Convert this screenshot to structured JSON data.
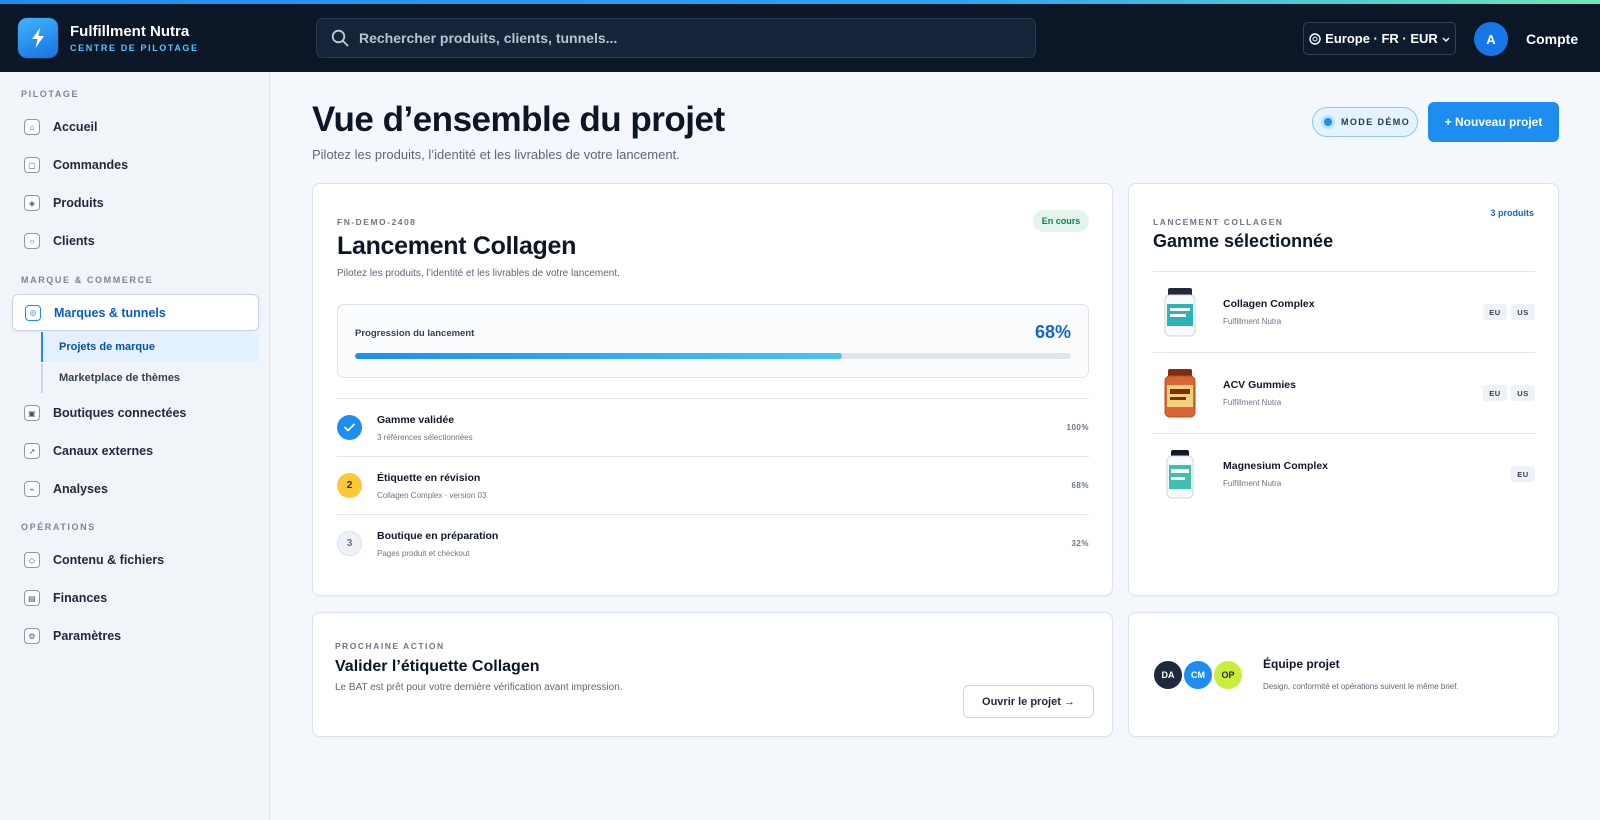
{
  "app": {
    "brand_name": "Fulfillment Nutra",
    "brand_sub": "CENTRE DE PILOTAGE",
    "search_placeholder": "Rechercher produits, clients, tunnels...",
    "region": "Europe · FR · EUR",
    "avatar_initial": "A",
    "account_label": "Compte"
  },
  "sidebar": {
    "sections": [
      "PILOTAGE",
      "MARQUE & COMMERCE",
      "OPÉRATIONS"
    ],
    "items": [
      {
        "label": "Accueil",
        "icon": "home-icon"
      },
      {
        "label": "Commandes",
        "icon": "orders-icon"
      },
      {
        "label": "Produits",
        "icon": "products-icon"
      },
      {
        "label": "Clients",
        "icon": "clients-icon"
      },
      {
        "label": "Marques & tunnels",
        "icon": "brands-icon"
      },
      {
        "label": "Boutiques connectées",
        "icon": "shops-icon"
      },
      {
        "label": "Canaux externes",
        "icon": "external-channels-icon"
      },
      {
        "label": "Analyses",
        "icon": "analytics-icon"
      },
      {
        "label": "Contenu & fichiers",
        "icon": "content-icon"
      },
      {
        "label": "Finances",
        "icon": "finances-icon"
      },
      {
        "label": "Paramètres",
        "icon": "settings-icon"
      }
    ],
    "sub_items": [
      {
        "label": "Projets de marque"
      },
      {
        "label": "Marketplace de thèmes"
      }
    ]
  },
  "header": {
    "title": "Vue d’ensemble du projet",
    "subtitle": "Pilotez les produits, l’identité et les livrables de votre lancement.",
    "demo_label": "MODE DÉMO",
    "new_project_label": "+ Nouveau projet"
  },
  "project": {
    "code": "FN-DEMO-2408",
    "status": "En cours",
    "title": "Lancement Collagen",
    "subtitle": "Pilotez les produits, l’identité et les livrables de votre lancement.",
    "progress_label": "Progression du lancement",
    "progress_text": "68%",
    "progress_value": 68,
    "steps": [
      {
        "badge": "✓",
        "title": "Gamme validée",
        "sub": "3 références sélectionnées",
        "pct": "100%"
      },
      {
        "badge": "2",
        "title": "Étiquette en révision",
        "sub": "Collagen Complex · version 03",
        "pct": "68%"
      },
      {
        "badge": "3",
        "title": "Boutique en préparation",
        "sub": "Pages produit et checkout",
        "pct": "32%"
      }
    ]
  },
  "range": {
    "eyebrow": "LANCEMENT COLLAGEN",
    "title": "Gamme sélectionnée",
    "count": "3 produits",
    "products": [
      {
        "name": "Collagen Complex",
        "brand": "Fulfillment Nutra",
        "tags": [
          "EU",
          "US"
        ],
        "color": "#2bb3b8"
      },
      {
        "name": "ACV Gummies",
        "brand": "Fulfillment Nutra",
        "tags": [
          "EU",
          "US"
        ],
        "color": "#c2522b"
      },
      {
        "name": "Magnesium Complex",
        "brand": "Fulfillment Nutra",
        "tags": [
          "EU"
        ],
        "color": "#3fbfae"
      }
    ]
  },
  "next_action": {
    "eyebrow": "PROCHAINE ACTION",
    "title": "Valider l’étiquette Collagen",
    "subtitle": "Le BAT est prêt pour votre dernière vérification avant impression.",
    "button_label": "Ouvrir le projet →"
  },
  "team": {
    "members": [
      "DA",
      "CM",
      "OP"
    ],
    "title": "Équipe projet",
    "subtitle": "Design, conformité et opérations suivent le même brief."
  }
}
